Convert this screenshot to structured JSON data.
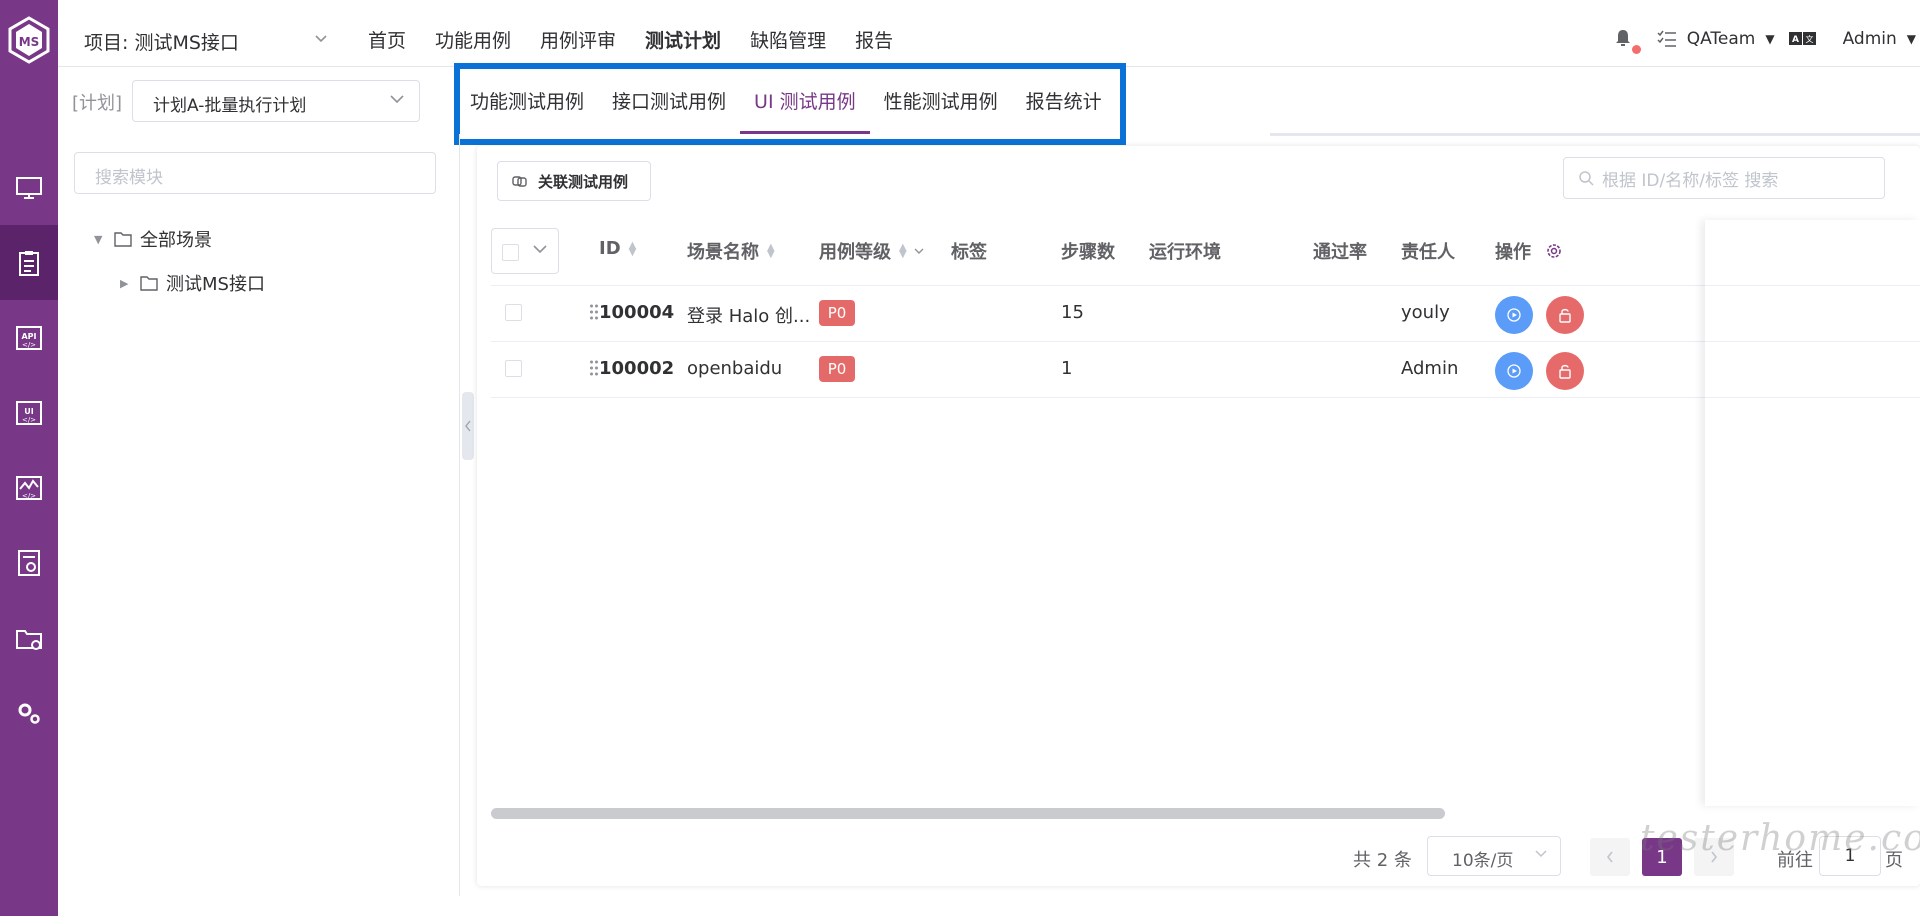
{
  "project": {
    "label": "项目: 测试MS接口"
  },
  "topnav": [
    {
      "label": "首页",
      "active": false
    },
    {
      "label": "功能用例",
      "active": false
    },
    {
      "label": "用例评审",
      "active": false
    },
    {
      "label": "测试计划",
      "active": true
    },
    {
      "label": "缺陷管理",
      "active": false
    },
    {
      "label": "报告",
      "active": false
    }
  ],
  "topright": {
    "workspace": "QATeam",
    "user": "Admin"
  },
  "plan": {
    "label": "[计划]",
    "selected": "计划A-批量执行计划"
  },
  "tabs": [
    {
      "label": "功能测试用例",
      "active": false
    },
    {
      "label": "接口测试用例",
      "active": false
    },
    {
      "label": "UI 测试用例",
      "active": true
    },
    {
      "label": "性能测试用例",
      "active": false
    },
    {
      "label": "报告统计",
      "active": false
    }
  ],
  "tree": {
    "search_placeholder": "搜索模块",
    "root": "全部场景",
    "child": "测试MS接口"
  },
  "toolbar": {
    "link_button": "关联测试用例",
    "search_placeholder": "根据 ID/名称/标签 搜索"
  },
  "table": {
    "columns": [
      "ID",
      "场景名称",
      "用例等级",
      "标签",
      "步骤数",
      "运行环境",
      "通过率",
      "责任人",
      "操作"
    ],
    "rows": [
      {
        "id": "100004",
        "name": "登录 Halo 创...",
        "level": "P0",
        "tags": "",
        "steps": "15",
        "env": "",
        "pass_rate": "",
        "owner": "youly"
      },
      {
        "id": "100002",
        "name": "openbaidu",
        "level": "P0",
        "tags": "",
        "steps": "1",
        "env": "",
        "pass_rate": "",
        "owner": "Admin"
      }
    ]
  },
  "pagination": {
    "total": "共 2 条",
    "page_size": "10条/页",
    "current_page": "1",
    "goto_label": "前往",
    "goto_value": "1",
    "goto_unit": "页"
  },
  "watermark": "testerhome.com",
  "colors": {
    "brand": "#783887",
    "highlight": "#0a72d6",
    "run": "#5a9cf8",
    "danger": "#e66a6a"
  }
}
